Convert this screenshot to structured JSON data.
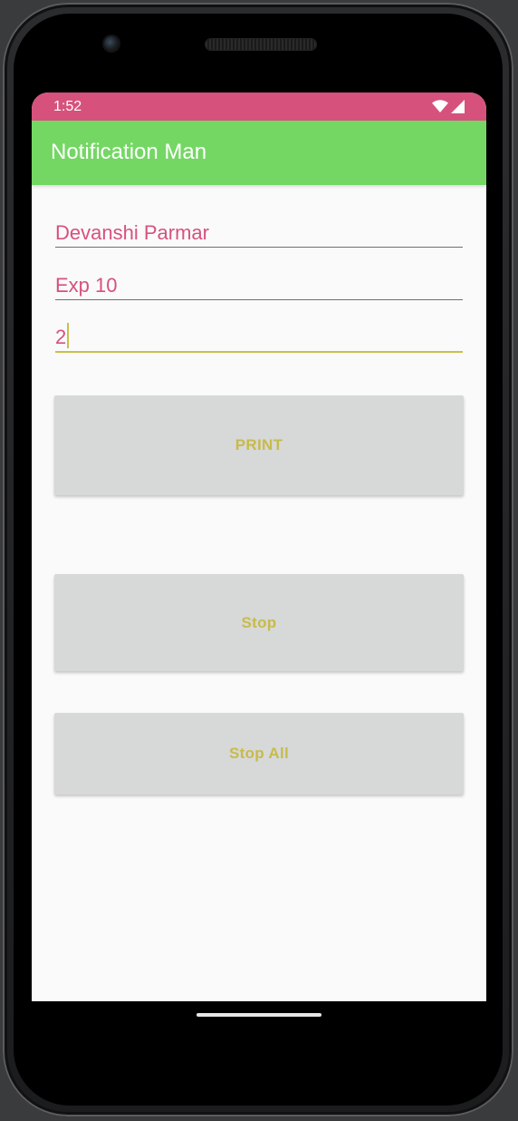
{
  "status_bar": {
    "time": "1:52",
    "color": "#d6527c",
    "icons": [
      "wifi-icon",
      "signal-icon"
    ]
  },
  "app_bar": {
    "title": "Notification Man",
    "color": "#74d764"
  },
  "fields": [
    {
      "value": "Devanshi Parmar"
    },
    {
      "value": "Exp 10"
    },
    {
      "value": "2",
      "focused": true
    }
  ],
  "buttons": {
    "print": "PRINT",
    "stop": "Stop",
    "stop_all": "Stop All"
  },
  "colors": {
    "text_accent": "#d6527c",
    "button_text": "#c7bb4a",
    "button_bg": "#d7d8d8",
    "focus_underline": "#c9c04a"
  }
}
